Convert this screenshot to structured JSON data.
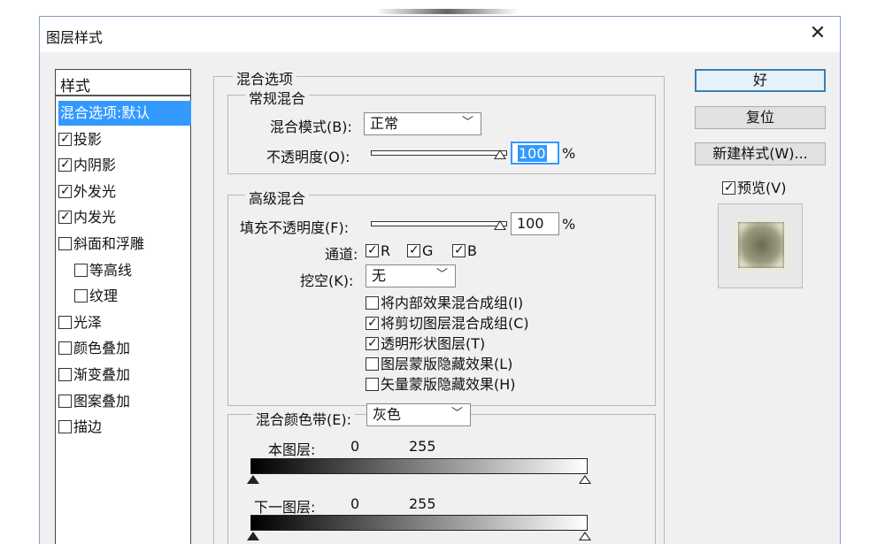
{
  "window": {
    "title": "图层样式"
  },
  "styles": {
    "header": "样式",
    "items": [
      {
        "label": "混合选项:默认",
        "checkbox": false,
        "checked": false,
        "selected": true
      },
      {
        "label": "投影",
        "checkbox": true,
        "checked": true
      },
      {
        "label": "内阴影",
        "checkbox": true,
        "checked": true
      },
      {
        "label": "外发光",
        "checkbox": true,
        "checked": true
      },
      {
        "label": "内发光",
        "checkbox": true,
        "checked": true
      },
      {
        "label": "斜面和浮雕",
        "checkbox": true,
        "checked": false
      },
      {
        "label": "等高线",
        "checkbox": true,
        "checked": false,
        "indent": true
      },
      {
        "label": "纹理",
        "checkbox": true,
        "checked": false,
        "indent": true
      },
      {
        "label": "光泽",
        "checkbox": true,
        "checked": false
      },
      {
        "label": "颜色叠加",
        "checkbox": true,
        "checked": false
      },
      {
        "label": "渐变叠加",
        "checkbox": true,
        "checked": false
      },
      {
        "label": "图案叠加",
        "checkbox": true,
        "checked": false
      },
      {
        "label": "描边",
        "checkbox": true,
        "checked": false
      }
    ]
  },
  "blend": {
    "section_title": "混合选项",
    "general": {
      "title": "常规混合",
      "mode_label": "混合模式(B):",
      "mode_value": "正常",
      "opacity_label": "不透明度(O):",
      "opacity_value": "100",
      "percent": "%"
    },
    "advanced": {
      "title": "高级混合",
      "fill_label": "填充不透明度(F):",
      "fill_value": "100",
      "percent": "%",
      "channels_label": "通道:",
      "channel_r": "R",
      "channel_g": "G",
      "channel_b": "B",
      "knockout_label": "挖空(K):",
      "knockout_value": "无",
      "options": [
        {
          "label": "将内部效果混合成组(I)",
          "checked": false
        },
        {
          "label": "将剪切图层混合成组(C)",
          "checked": true
        },
        {
          "label": "透明形状图层(T)",
          "checked": true
        },
        {
          "label": "图层蒙版隐藏效果(L)",
          "checked": false
        },
        {
          "label": "矢量蒙版隐藏效果(H)",
          "checked": false
        }
      ]
    },
    "blend_if": {
      "label": "混合颜色带(E):",
      "value": "灰色",
      "this_layer_label": "本图层:",
      "this_layer_min": "0",
      "this_layer_max": "255",
      "underlying_label": "下一图层:",
      "underlying_min": "0",
      "underlying_max": "255"
    }
  },
  "buttons": {
    "ok": "好",
    "reset": "复位",
    "new_style": "新建样式(W)...",
    "preview_label": "预览(V)"
  }
}
